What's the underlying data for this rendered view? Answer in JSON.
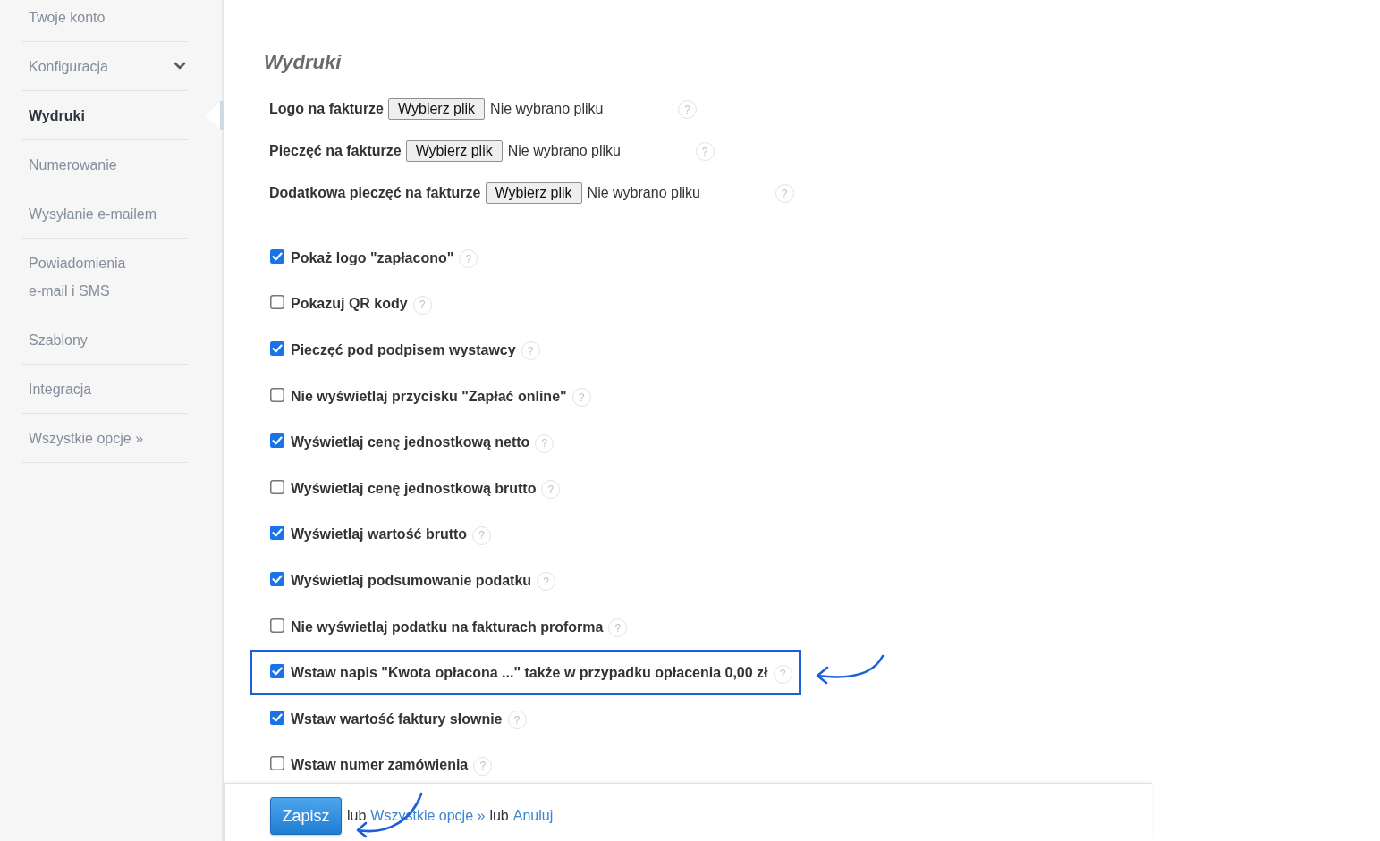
{
  "sidebar": {
    "items": [
      {
        "label": "Twoje konto",
        "kind": "link",
        "selected": false
      },
      {
        "label": "Konfiguracja",
        "kind": "group",
        "selected": false
      },
      {
        "label": "Wydruki",
        "kind": "link",
        "selected": true
      },
      {
        "label": "Numerowanie",
        "kind": "link",
        "selected": false
      },
      {
        "label": "Wysyłanie e-mailem",
        "kind": "link",
        "selected": false
      },
      {
        "label": "Powiadomienia\ne-mail i SMS",
        "kind": "link",
        "selected": false
      },
      {
        "label": "Szablony",
        "kind": "link",
        "selected": false
      },
      {
        "label": "Integracja",
        "kind": "link",
        "selected": false
      },
      {
        "label": "Wszystkie opcje »",
        "kind": "link",
        "selected": false
      }
    ]
  },
  "main": {
    "title": "Wydruki",
    "file_fields": [
      {
        "label": "Logo na fakturze",
        "button": "Wybierz plik",
        "status": "Nie wybrano pliku",
        "help": "?"
      },
      {
        "label": "Pieczęć na fakturze",
        "button": "Wybierz plik",
        "status": "Nie wybrano pliku",
        "help": "?"
      },
      {
        "label": "Dodatkowa pieczęć na fakturze",
        "button": "Wybierz plik",
        "status": "Nie wybrano pliku",
        "help": "?"
      }
    ],
    "options": [
      {
        "label": "Pokaż logo \"zapłacono\"",
        "checked": true,
        "highlighted": false,
        "help": "?"
      },
      {
        "label": "Pokazuj QR kody",
        "checked": false,
        "highlighted": false,
        "help": "?"
      },
      {
        "label": "Pieczęć pod podpisem wystawcy",
        "checked": true,
        "highlighted": false,
        "help": "?"
      },
      {
        "label": "Nie wyświetlaj przycisku \"Zapłać online\"",
        "checked": false,
        "highlighted": false,
        "help": "?"
      },
      {
        "label": "Wyświetlaj cenę jednostkową netto",
        "checked": true,
        "highlighted": false,
        "help": "?"
      },
      {
        "label": "Wyświetlaj cenę jednostkową brutto",
        "checked": false,
        "highlighted": false,
        "help": "?"
      },
      {
        "label": "Wyświetlaj wartość brutto",
        "checked": true,
        "highlighted": false,
        "help": "?"
      },
      {
        "label": "Wyświetlaj podsumowanie podatku",
        "checked": true,
        "highlighted": false,
        "help": "?"
      },
      {
        "label": "Nie wyświetlaj podatku na fakturach proforma",
        "checked": false,
        "highlighted": false,
        "help": "?"
      },
      {
        "label": "Wstaw napis \"Kwota opłacona ...\" także w przypadku opłacenia 0,00 zł",
        "checked": true,
        "highlighted": true,
        "help": "?"
      },
      {
        "label": "Wstaw wartość faktury słownie",
        "checked": true,
        "highlighted": false,
        "help": "?"
      },
      {
        "label": "Wstaw numer zamówienia",
        "checked": false,
        "highlighted": false,
        "help": "?"
      }
    ]
  },
  "footer": {
    "save_button": "Zapisz",
    "save_arrow": true,
    "parts": [
      {
        "kind": "text",
        "text": "lub"
      },
      {
        "kind": "link",
        "text": "Wszystkie opcje »"
      },
      {
        "kind": "text",
        "text": "lub"
      },
      {
        "kind": "link",
        "text": "Anuluj"
      }
    ]
  }
}
